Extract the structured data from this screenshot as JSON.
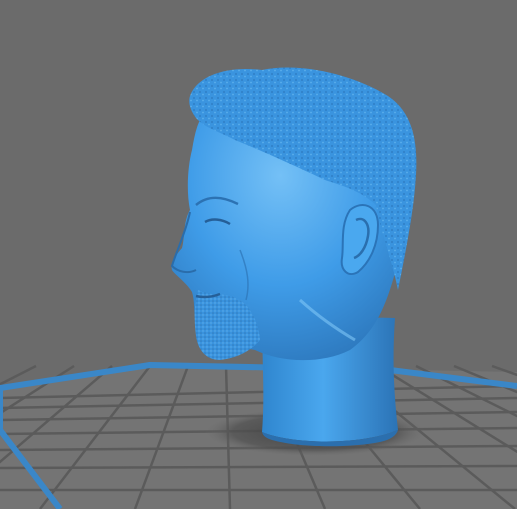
{
  "viewport": {
    "background_color": "#6b6b6b",
    "bed_color": "#747474",
    "bed_grid_color": "#5b5b5b",
    "bed_border_color": "#3a87c8",
    "model_color": "#3f9ce8",
    "model_shadow_color": "#3f6f99",
    "model_highlight_color": "#72bdf4",
    "model_icon": "head-bust-model"
  }
}
